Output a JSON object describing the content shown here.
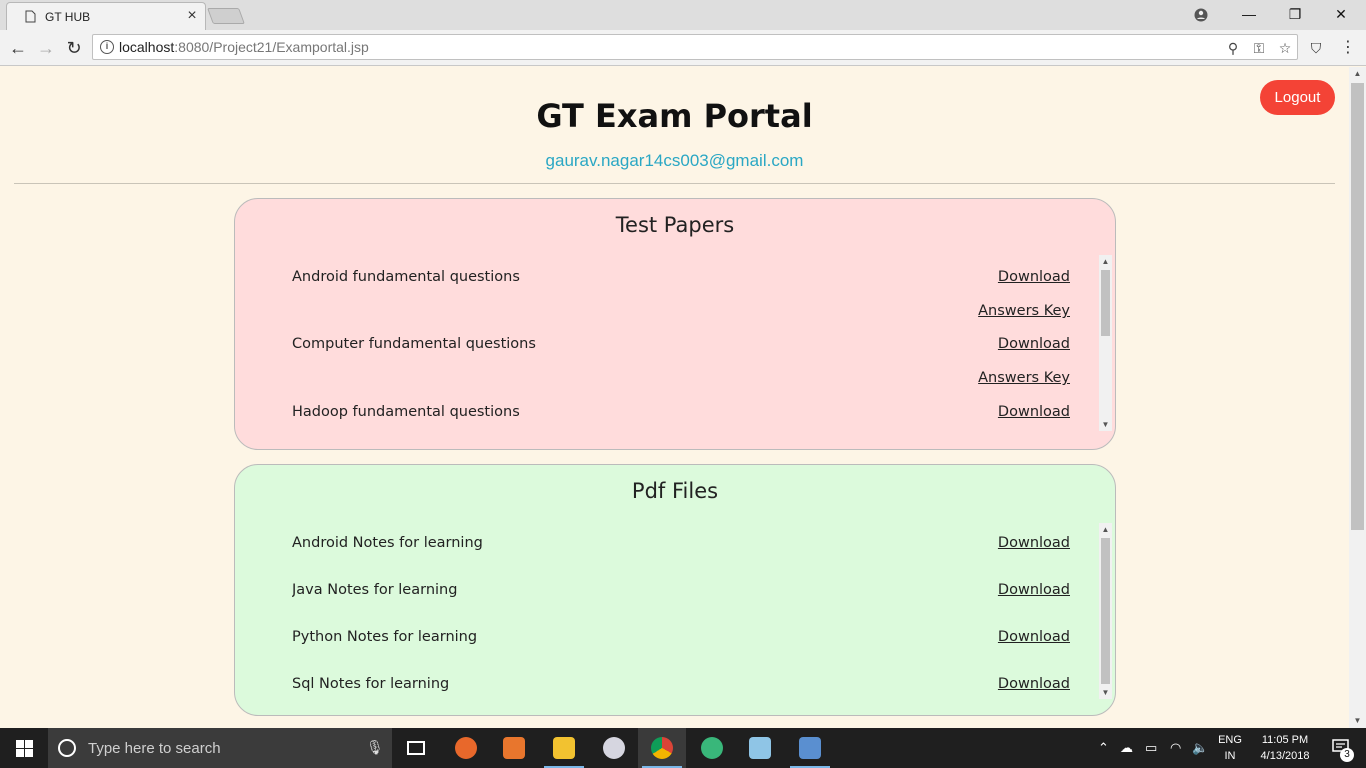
{
  "browser": {
    "tab_title": "GT HUB",
    "tab_close": "×",
    "url_host": "localhost",
    "url_rest": ":8080/Project21/Examportal.jsp",
    "window_controls": {
      "minimize": "—",
      "restore": "❐",
      "close": "✕"
    }
  },
  "page": {
    "title": "GT Exam Portal",
    "email": "gaurav.nagar14cs003@gmail.com",
    "logout_label": "Logout"
  },
  "test_papers": {
    "title": "Test Papers",
    "items": [
      {
        "name": "Android fundamental questions",
        "link": "Download"
      },
      {
        "name": "",
        "link": "Answers Key"
      },
      {
        "name": "Computer fundamental questions",
        "link": "Download"
      },
      {
        "name": "",
        "link": "Answers Key"
      },
      {
        "name": "Hadoop fundamental questions",
        "link": "Download"
      }
    ]
  },
  "pdf_files": {
    "title": "Pdf Files",
    "items": [
      {
        "name": "Android Notes for learning",
        "link": "Download"
      },
      {
        "name": "Java Notes for learning",
        "link": "Download"
      },
      {
        "name": "Python Notes for learning",
        "link": "Download"
      },
      {
        "name": "Sql Notes for learning",
        "link": "Download"
      }
    ]
  },
  "taskbar": {
    "search_placeholder": "Type here to search",
    "lang_top": "ENG",
    "lang_bottom": "IN",
    "time": "11:05 PM",
    "date": "4/13/2018",
    "notification_count": "3",
    "apps": [
      "task-view",
      "firefox",
      "media-player",
      "file-explorer",
      "paint",
      "chrome",
      "atom",
      "notepad",
      "virtualbox"
    ]
  },
  "colors": {
    "page_bg": "#fdf5e6",
    "logout": "#f44336",
    "email": "#2aa7c4",
    "panel_pink": "#ffdcdc",
    "panel_green": "#dcfadc"
  }
}
